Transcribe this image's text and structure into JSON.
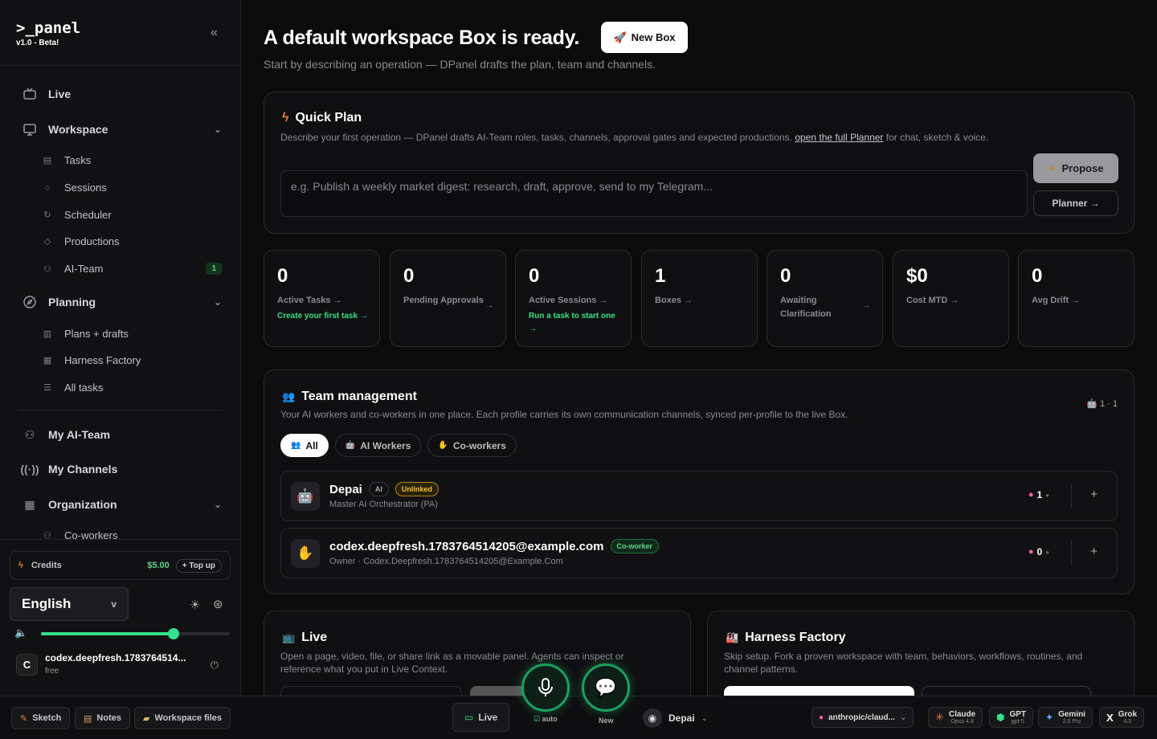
{
  "sidebar": {
    "logo": ">_panel",
    "version": "v1.0 - Beta!",
    "items": {
      "live": "Live",
      "workspace": "Workspace",
      "tasks": "Tasks",
      "sessions": "Sessions",
      "scheduler": "Scheduler",
      "productions": "Productions",
      "ai_team": "AI-Team",
      "ai_team_badge": "1",
      "planning": "Planning",
      "plans_drafts": "Plans + drafts",
      "harness_factory": "Harness Factory",
      "all_tasks": "All tasks",
      "my_ai_team": "My AI-Team",
      "my_channels": "My Channels",
      "organization": "Organization",
      "co_workers": "Co-workers"
    },
    "credits": {
      "label": "Credits",
      "amount": "$5.00",
      "topup": "+ Top up"
    },
    "language": {
      "value": "English",
      "chev": "v"
    },
    "volume": 0.7,
    "user": {
      "initial": "C",
      "name": "codex.deepfresh.1783764514...",
      "plan": "free"
    }
  },
  "header": {
    "title": "A default workspace Box is ready.",
    "new_box": "New Box",
    "subtitle": "Start by describing an operation — DPanel drafts the plan, team and channels."
  },
  "quick_plan": {
    "title": "Quick Plan",
    "desc_pre": "Describe your first operation — DPanel drafts AI-Team roles, tasks, channels, approval gates and expected productions. ",
    "desc_link": "open the full Planner",
    "desc_post": " for chat, sketch & voice.",
    "placeholder": "e.g. Publish a weekly market digest: research, draft, approve, send to my Telegram...",
    "propose": "Propose",
    "planner": "Planner →"
  },
  "stats": [
    {
      "value": "0",
      "label": "Active Tasks →",
      "cta": "Create your first task →"
    },
    {
      "value": "0",
      "label": "Pending Approvals",
      "arrow": "→"
    },
    {
      "value": "0",
      "label": "Active Sessions →",
      "cta": "Run a task to start one →"
    },
    {
      "value": "1",
      "label": "Boxes →"
    },
    {
      "value": "0",
      "label": "Awaiting Clarification",
      "arrow": "→"
    },
    {
      "value": "$0",
      "label": "Cost MTD →"
    },
    {
      "value": "0",
      "label": "Avg Drift →"
    }
  ],
  "team": {
    "title": "Team management",
    "desc": "Your AI workers and co-workers in one place. Each profile carries its own communication channels, synced per-profile to the live Box.",
    "counts": "1 · 1",
    "tabs": [
      "All",
      "AI Workers",
      "Co-workers"
    ],
    "members": [
      {
        "name": "Depai",
        "tag1": "AI",
        "tag2": "Unlinked",
        "role": "Master AI Orchestrator (PA)",
        "count": "1"
      },
      {
        "name": "codex.deepfresh.1783764514205@example.com",
        "tag1": "Co-worker",
        "role": "Owner · Codex.Deepfresh.1783764514205@Example.Com",
        "count": "0"
      }
    ]
  },
  "live_card": {
    "title": "Live",
    "desc": "Open a page, video, file, or share link as a movable panel. Agents can inspect or reference what you put in Live Context."
  },
  "harness_card": {
    "title": "Harness Factory",
    "desc": "Skip setup. Fork a proven workspace with team, behaviors, workflows, routines, and channel patterns."
  },
  "bottom": {
    "sketch": "Sketch",
    "notes": "Notes",
    "workspace_files": "Workspace files",
    "live": "Live",
    "auto": "auto",
    "new": "New",
    "agent": "Depai",
    "model_select": "anthropic/claud...",
    "models": [
      {
        "name": "Claude",
        "sub": "Opus 4.8"
      },
      {
        "name": "GPT",
        "sub": "gpt-5"
      },
      {
        "name": "Gemini",
        "sub": "2.5 Pro"
      },
      {
        "name": "Grok",
        "sub": "4.5"
      }
    ]
  }
}
